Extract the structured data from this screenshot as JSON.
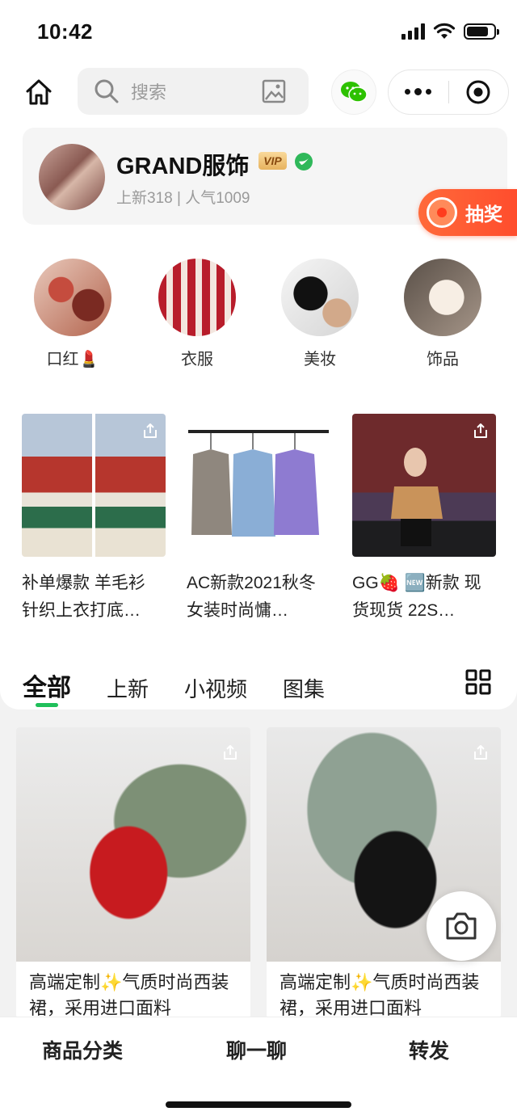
{
  "status_bar": {
    "time": "10:42"
  },
  "search": {
    "placeholder": "搜索"
  },
  "shop": {
    "name": "GRAND服饰",
    "badge": "VIP",
    "stats": "上新318 | 人气1009"
  },
  "lottery": {
    "label": "抽奖"
  },
  "categories": [
    {
      "label": "口红💄"
    },
    {
      "label": "衣服"
    },
    {
      "label": "美妆"
    },
    {
      "label": "饰品"
    }
  ],
  "featured": [
    {
      "title": "补单爆款 羊毛衫 针织上衣打底…"
    },
    {
      "title": "AC新款2021秋冬女装时尚慵…"
    },
    {
      "title": "GG🍓 🆕新款 现货现货 22S…"
    }
  ],
  "tabs": [
    {
      "label": "全部",
      "active": true
    },
    {
      "label": "上新"
    },
    {
      "label": "小视频"
    },
    {
      "label": "图集"
    }
  ],
  "products": [
    {
      "title": "高端定制✨气质时尚西装裙，采用进口面料"
    },
    {
      "title": "高端定制✨气质时尚西装裙，采用进口面料"
    }
  ],
  "bottom_bar": {
    "category": "商品分类",
    "chat": "聊一聊",
    "forward": "转发"
  },
  "colors": {
    "accent_green": "#1fbf5a",
    "lottery_orange": "#ff5a32"
  }
}
